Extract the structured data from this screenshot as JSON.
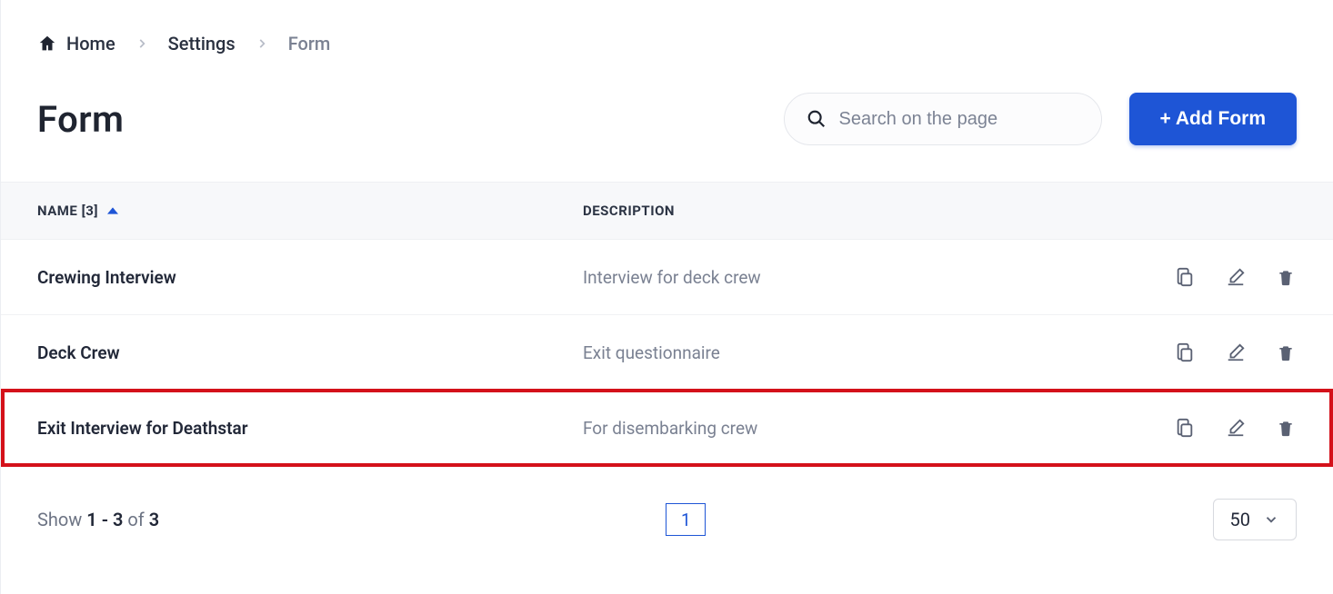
{
  "breadcrumb": {
    "home": "Home",
    "settings": "Settings",
    "current": "Form"
  },
  "page_title": "Form",
  "search": {
    "placeholder": "Search on the page"
  },
  "buttons": {
    "add_form": "+ Add Form"
  },
  "table": {
    "name_count": 3,
    "headers": {
      "name": "NAME",
      "description": "DESCRIPTION"
    },
    "rows": [
      {
        "name": "Crewing Interview",
        "description": "Interview for deck crew",
        "highlight": false
      },
      {
        "name": "Deck Crew",
        "description": "Exit questionnaire",
        "highlight": false
      },
      {
        "name": "Exit Interview for Deathstar",
        "description": "For disembarking crew",
        "highlight": true
      }
    ]
  },
  "pagination": {
    "show_prefix": "Show ",
    "range": "1 - 3",
    "of": " of ",
    "total": "3",
    "current_page": "1",
    "per_page": "50"
  }
}
